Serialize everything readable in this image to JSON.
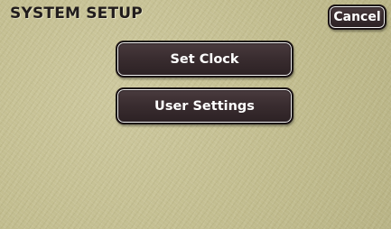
{
  "screen": {
    "title": "SYSTEM SETUP"
  },
  "header": {
    "cancel_label": "Cancel"
  },
  "menu": {
    "items": [
      {
        "label": "Set Clock"
      },
      {
        "label": "User Settings"
      }
    ]
  },
  "colors": {
    "background": "#c4bf92",
    "button_fill": "#3a2d30",
    "button_border": "#1a1213",
    "button_text": "#ffffff",
    "title_text": "#211c1c"
  }
}
